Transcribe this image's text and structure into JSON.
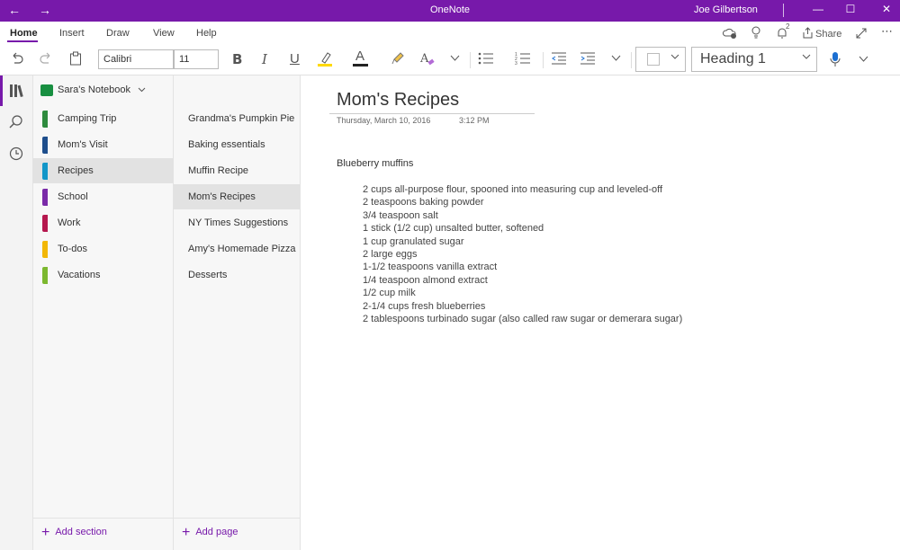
{
  "titlebar": {
    "app_title": "OneNote",
    "user_name": "Joe Gilbertson",
    "back_icon": "←",
    "forward_icon": "→",
    "minimize_icon": "—",
    "maximize_icon": "☐",
    "close_icon": "✕",
    "accent_color": "#7719aa"
  },
  "ribbon": {
    "tabs": [
      {
        "label": "Home",
        "active": true
      },
      {
        "label": "Insert",
        "active": false
      },
      {
        "label": "Draw",
        "active": false
      },
      {
        "label": "View",
        "active": false
      },
      {
        "label": "Help",
        "active": false
      }
    ],
    "notification_count": "2",
    "share_label": "Share",
    "more_icon": "⋯"
  },
  "toolbar": {
    "font_name": "Calibri",
    "font_size": "11",
    "bold": "B",
    "italic": "I",
    "underline": "U",
    "font_color_glyph": "A",
    "style_value": "Heading 1",
    "highlight_color": "#ffd900",
    "font_color": "#222222"
  },
  "notebook": {
    "name": "Sara's Notebook",
    "color": "#188f41"
  },
  "sections": [
    {
      "label": "Camping Trip",
      "color": "#2e8b3e"
    },
    {
      "label": "Mom's Visit",
      "color": "#1e4e8c"
    },
    {
      "label": "Recipes",
      "color": "#1296c8",
      "selected": true
    },
    {
      "label": "School",
      "color": "#7a2aa8"
    },
    {
      "label": "Work",
      "color": "#b5174e"
    },
    {
      "label": "To-dos",
      "color": "#f2b705"
    },
    {
      "label": "Vacations",
      "color": "#7cb82f"
    }
  ],
  "pages": [
    {
      "label": "Grandma's Pumpkin Pie"
    },
    {
      "label": "Baking essentials"
    },
    {
      "label": "Muffin Recipe"
    },
    {
      "label": "Mom's Recipes",
      "selected": true
    },
    {
      "label": "NY Times Suggestions"
    },
    {
      "label": "Amy's Homemade Pizza"
    },
    {
      "label": "Desserts"
    }
  ],
  "add_section_label": "Add section",
  "add_page_label": "Add page",
  "page": {
    "title": "Mom's Recipes",
    "date": "Thursday, March 10, 2016",
    "time": "3:12 PM",
    "heading": "Blueberry muffins",
    "ingredients": [
      "2 cups all-purpose flour, spooned into measuring cup and leveled-off",
      "2 teaspoons baking powder",
      "3/4 teaspoon salt",
      "1 stick (1/2 cup) unsalted butter, softened",
      "1 cup granulated sugar",
      "2 large eggs",
      "1-1/2 teaspoons vanilla extract",
      "1/4 teaspoon almond extract",
      "1/2 cup milk",
      "2-1/4 cups fresh blueberries",
      "2 tablespoons turbinado sugar (also called raw sugar or demerara sugar)"
    ]
  }
}
